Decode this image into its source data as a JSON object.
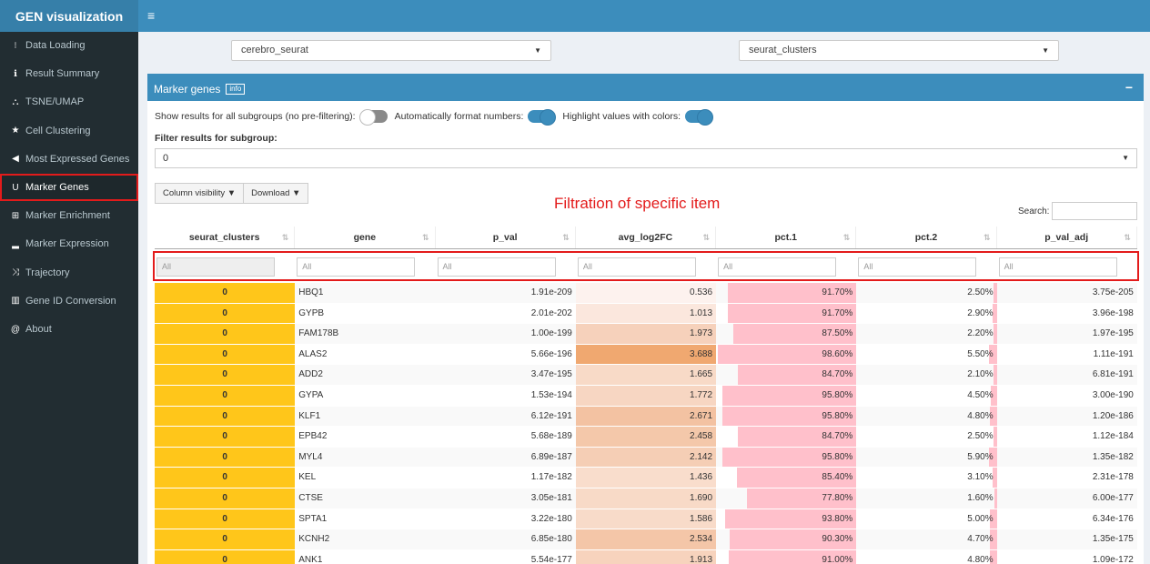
{
  "app": {
    "title": "GEN visualization"
  },
  "sidebar": {
    "items": [
      {
        "label": "Data Loading",
        "icon": "spinner-icon",
        "glyph": "⁝"
      },
      {
        "label": "Result Summary",
        "icon": "info-icon",
        "glyph": "ℹ"
      },
      {
        "label": "TSNE/UMAP",
        "icon": "binoculars-icon",
        "glyph": "⛬"
      },
      {
        "label": "Cell Clustering",
        "icon": "star-icon",
        "glyph": "★"
      },
      {
        "label": "Most Expressed Genes",
        "icon": "bullhorn-icon",
        "glyph": "◀"
      },
      {
        "label": "Marker Genes",
        "icon": "magnet-icon",
        "glyph": "U",
        "active": true
      },
      {
        "label": "Marker Enrichment",
        "icon": "sitemap-icon",
        "glyph": "⊞"
      },
      {
        "label": "Marker Expression",
        "icon": "signal-icon",
        "glyph": "▂"
      },
      {
        "label": "Trajectory",
        "icon": "random-icon",
        "glyph": "⤨"
      },
      {
        "label": "Gene ID Conversion",
        "icon": "barcode-icon",
        "glyph": "▥"
      },
      {
        "label": "About",
        "icon": "at-icon",
        "glyph": "@"
      }
    ]
  },
  "top_selects": {
    "dataset": "cerebro_seurat",
    "grouping": "seurat_clusters"
  },
  "box": {
    "title": "Marker genes",
    "info_label": "info",
    "collapse": "−",
    "opt_all": "Show results for all subgroups (no pre-filtering):",
    "opt_format": "Automatically format numbers:",
    "opt_colors": "Highlight values with colors:",
    "filter_label": "Filter results for subgroup:",
    "filter_value": "0",
    "btn_columns": "Column visibility ▼",
    "btn_download": "Download ▼",
    "search_label": "Search:",
    "annotation": "Filtration of specific item"
  },
  "table": {
    "columns": [
      "seurat_clusters",
      "gene",
      "p_val",
      "avg_log2FC",
      "pct.1",
      "pct.2",
      "p_val_adj"
    ],
    "filter_placeholder": "All",
    "rows": [
      {
        "cluster": "0",
        "gene": "HBQ1",
        "p_val": "1.91e-209",
        "fc": "0.536",
        "fc_color": "#fdf2ee",
        "pct1": "91.70%",
        "pct1_v": 0.917,
        "pct2": "2.50%",
        "pct2_v": 0.025,
        "p_adj": "3.75e-205"
      },
      {
        "cluster": "0",
        "gene": "GYPB",
        "p_val": "2.01e-202",
        "fc": "1.013",
        "fc_color": "#fbe7dd",
        "pct1": "91.70%",
        "pct1_v": 0.917,
        "pct2": "2.90%",
        "pct2_v": 0.029,
        "p_adj": "3.96e-198"
      },
      {
        "cluster": "0",
        "gene": "FAM178B",
        "p_val": "1.00e-199",
        "fc": "1.973",
        "fc_color": "#f6d1bb",
        "pct1": "87.50%",
        "pct1_v": 0.875,
        "pct2": "2.20%",
        "pct2_v": 0.022,
        "p_adj": "1.97e-195"
      },
      {
        "cluster": "0",
        "gene": "ALAS2",
        "p_val": "5.66e-196",
        "fc": "3.688",
        "fc_color": "#f0a870",
        "pct1": "98.60%",
        "pct1_v": 0.986,
        "pct2": "5.50%",
        "pct2_v": 0.055,
        "p_adj": "1.11e-191"
      },
      {
        "cluster": "0",
        "gene": "ADD2",
        "p_val": "3.47e-195",
        "fc": "1.665",
        "fc_color": "#f8dac7",
        "pct1": "84.70%",
        "pct1_v": 0.847,
        "pct2": "2.10%",
        "pct2_v": 0.021,
        "p_adj": "6.81e-191"
      },
      {
        "cluster": "0",
        "gene": "GYPA",
        "p_val": "1.53e-194",
        "fc": "1.772",
        "fc_color": "#f7d6c2",
        "pct1": "95.80%",
        "pct1_v": 0.958,
        "pct2": "4.50%",
        "pct2_v": 0.045,
        "p_adj": "3.00e-190"
      },
      {
        "cluster": "0",
        "gene": "KLF1",
        "p_val": "6.12e-191",
        "fc": "2.671",
        "fc_color": "#f3c2a2",
        "pct1": "95.80%",
        "pct1_v": 0.958,
        "pct2": "4.80%",
        "pct2_v": 0.048,
        "p_adj": "1.20e-186"
      },
      {
        "cluster": "0",
        "gene": "EPB42",
        "p_val": "5.68e-189",
        "fc": "2.458",
        "fc_color": "#f4c8aa",
        "pct1": "84.70%",
        "pct1_v": 0.847,
        "pct2": "2.50%",
        "pct2_v": 0.025,
        "p_adj": "1.12e-184"
      },
      {
        "cluster": "0",
        "gene": "MYL4",
        "p_val": "6.89e-187",
        "fc": "2.142",
        "fc_color": "#f5ceb5",
        "pct1": "95.80%",
        "pct1_v": 0.958,
        "pct2": "5.90%",
        "pct2_v": 0.059,
        "p_adj": "1.35e-182"
      },
      {
        "cluster": "0",
        "gene": "KEL",
        "p_val": "1.17e-182",
        "fc": "1.436",
        "fc_color": "#f9ddcc",
        "pct1": "85.40%",
        "pct1_v": 0.854,
        "pct2": "3.10%",
        "pct2_v": 0.031,
        "p_adj": "2.31e-178"
      },
      {
        "cluster": "0",
        "gene": "CTSE",
        "p_val": "3.05e-181",
        "fc": "1.690",
        "fc_color": "#f8dac7",
        "pct1": "77.80%",
        "pct1_v": 0.778,
        "pct2": "1.60%",
        "pct2_v": 0.016,
        "p_adj": "6.00e-177"
      },
      {
        "cluster": "0",
        "gene": "SPTA1",
        "p_val": "3.22e-180",
        "fc": "1.586",
        "fc_color": "#f8dbc9",
        "pct1": "93.80%",
        "pct1_v": 0.938,
        "pct2": "5.00%",
        "pct2_v": 0.05,
        "p_adj": "6.34e-176"
      },
      {
        "cluster": "0",
        "gene": "KCNH2",
        "p_val": "6.85e-180",
        "fc": "2.534",
        "fc_color": "#f4c6a8",
        "pct1": "90.30%",
        "pct1_v": 0.903,
        "pct2": "4.70%",
        "pct2_v": 0.047,
        "p_adj": "1.35e-175"
      },
      {
        "cluster": "0",
        "gene": "ANK1",
        "p_val": "5.54e-177",
        "fc": "1.913",
        "fc_color": "#f7d3bd",
        "pct1": "91.00%",
        "pct1_v": 0.91,
        "pct2": "4.80%",
        "pct2_v": 0.048,
        "p_adj": "1.09e-172"
      }
    ]
  },
  "colors": {
    "accent": "#3c8dbc",
    "cluster": "#ffc61a",
    "pct_bar": "#ffc0cb",
    "highlight_box": "#e31b1b"
  }
}
